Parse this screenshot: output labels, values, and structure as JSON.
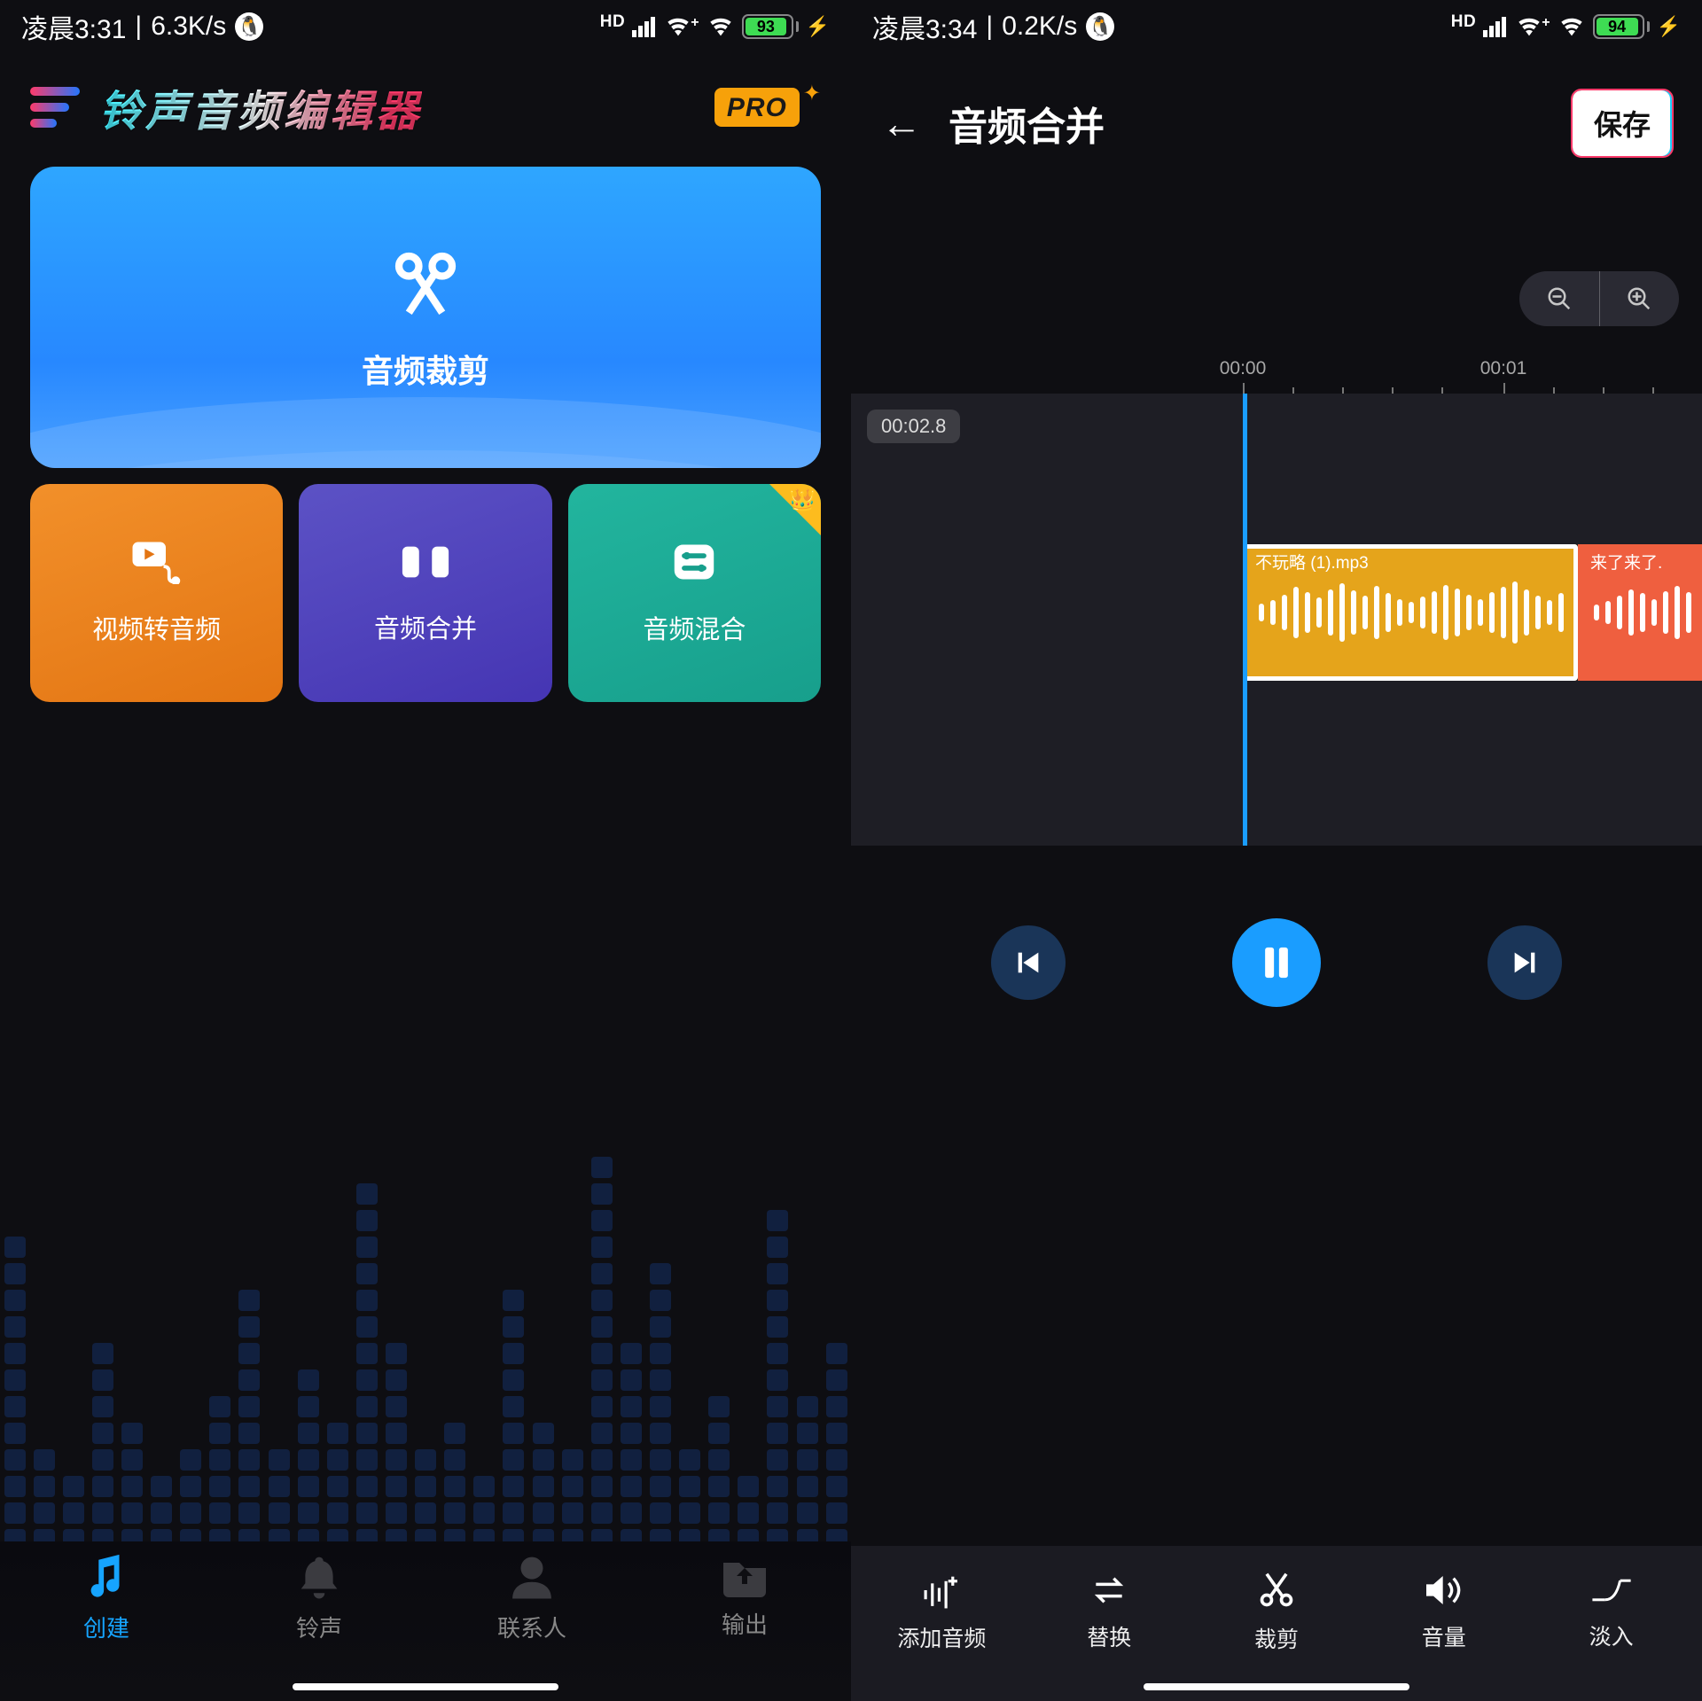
{
  "left": {
    "status": {
      "time": "凌晨3:31",
      "speed": "6.3K/s",
      "hd": "HD",
      "battery_pct": "93",
      "charging": "⚡"
    },
    "app_title": "铃声音频编辑器",
    "pro_label": "PRO",
    "main_card_label": "音频裁剪",
    "cards": [
      {
        "label": "视频转音频"
      },
      {
        "label": "音频合并"
      },
      {
        "label": "音频混合"
      }
    ],
    "nav": [
      {
        "label": "创建"
      },
      {
        "label": "铃声"
      },
      {
        "label": "联系人"
      },
      {
        "label": "输出"
      }
    ]
  },
  "right": {
    "status": {
      "time": "凌晨3:34",
      "speed": "0.2K/s",
      "hd": "HD",
      "battery_pct": "94",
      "charging": "⚡"
    },
    "title": "音频合并",
    "save_label": "保存",
    "zoom_out": "⊖",
    "zoom_in": "⊕",
    "ruler": {
      "t0": "00:00",
      "t1": "00:01"
    },
    "time_badge": "00:02.8",
    "clips": [
      {
        "label": "不玩略 (1).mp3"
      },
      {
        "label": "来了来了."
      }
    ],
    "tools": [
      {
        "label": "添加音频"
      },
      {
        "label": "替换"
      },
      {
        "label": "裁剪"
      },
      {
        "label": "音量"
      },
      {
        "label": "淡入"
      }
    ]
  },
  "eq_heights": [
    12,
    4,
    3,
    8,
    5,
    3,
    4,
    6,
    10,
    4,
    7,
    5,
    14,
    8,
    4,
    5,
    3,
    10,
    5,
    4,
    15,
    8,
    11,
    4,
    6,
    3,
    13,
    6,
    8
  ],
  "wave1": [
    20,
    28,
    40,
    58,
    46,
    34,
    52,
    66,
    50,
    38,
    60,
    44,
    30,
    24,
    36,
    48,
    62,
    54,
    40,
    30,
    46,
    58,
    70,
    52,
    38,
    28,
    44
  ],
  "wave2": [
    18,
    26,
    38,
    52,
    44,
    30,
    48,
    60,
    46
  ]
}
